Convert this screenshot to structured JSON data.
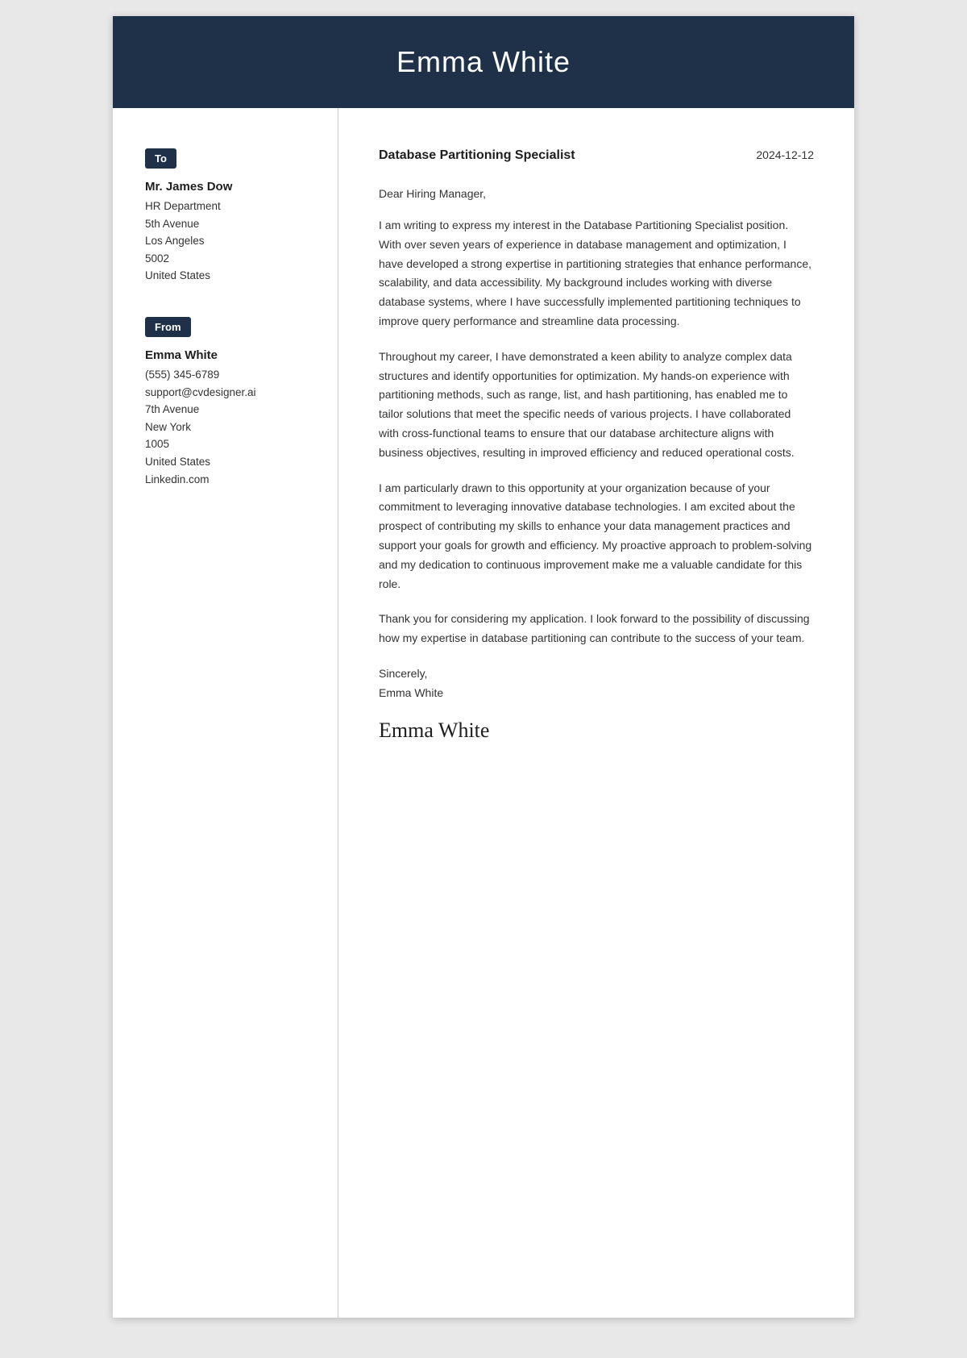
{
  "header": {
    "name": "Emma White"
  },
  "sidebar": {
    "to_badge": "To",
    "from_badge": "From",
    "to": {
      "name": "Mr. James Dow",
      "line1": "HR Department",
      "line2": "5th Avenue",
      "line3": "Los Angeles",
      "line4": "5002",
      "line5": "United States"
    },
    "from": {
      "name": "Emma White",
      "phone": "(555) 345-6789",
      "email": "support@cvdesigner.ai",
      "line1": "7th Avenue",
      "line2": "New York",
      "line3": "1005",
      "line4": "United States",
      "line5": "Linkedin.com"
    }
  },
  "letter": {
    "job_title": "Database Partitioning Specialist",
    "date": "2024-12-12",
    "salutation": "Dear Hiring Manager,",
    "paragraph1": "I am writing to express my interest in the Database Partitioning Specialist position. With over seven years of experience in database management and optimization, I have developed a strong expertise in partitioning strategies that enhance performance, scalability, and data accessibility. My background includes working with diverse database systems, where I have successfully implemented partitioning techniques to improve query performance and streamline data processing.",
    "paragraph2": "Throughout my career, I have demonstrated a keen ability to analyze complex data structures and identify opportunities for optimization. My hands-on experience with partitioning methods, such as range, list, and hash partitioning, has enabled me to tailor solutions that meet the specific needs of various projects. I have collaborated with cross-functional teams to ensure that our database architecture aligns with business objectives, resulting in improved efficiency and reduced operational costs.",
    "paragraph3": "I am particularly drawn to this opportunity at your organization because of your commitment to leveraging innovative database technologies. I am excited about the prospect of contributing my skills to enhance your data management practices and support your goals for growth and efficiency. My proactive approach to problem-solving and my dedication to continuous improvement make me a valuable candidate for this role.",
    "paragraph4": "Thank you for considering my application. I look forward to the possibility of discussing how my expertise in database partitioning can contribute to the success of your team.",
    "closing_line1": "Sincerely,",
    "closing_line2": "Emma White",
    "signature": "Emma White"
  }
}
